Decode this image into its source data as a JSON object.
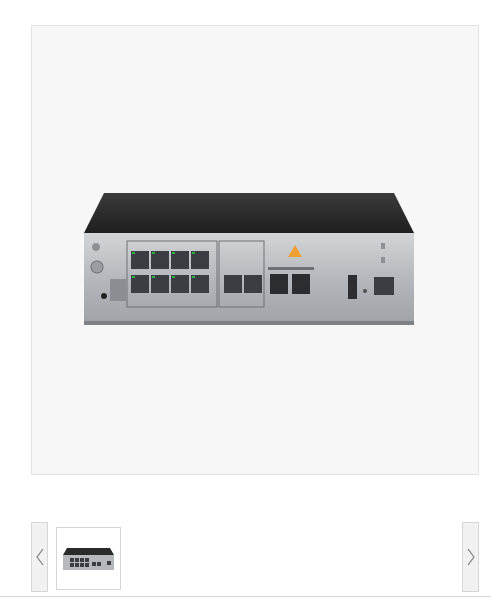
{
  "gallery": {
    "main_image": {
      "icon": "network-firewall-device-image"
    },
    "prev_button": {
      "icon": "chevron-left-icon"
    },
    "next_button": {
      "icon": "chevron-right-icon"
    },
    "thumbnails": [
      {
        "icon": "network-firewall-device-thumbnail",
        "selected": true
      }
    ]
  },
  "colors": {
    "frame_bg": "#f7f7f7",
    "device_top": "#2a2a2a",
    "device_panel": "#b9bcc0",
    "warning_triangle": "#f0a030"
  }
}
